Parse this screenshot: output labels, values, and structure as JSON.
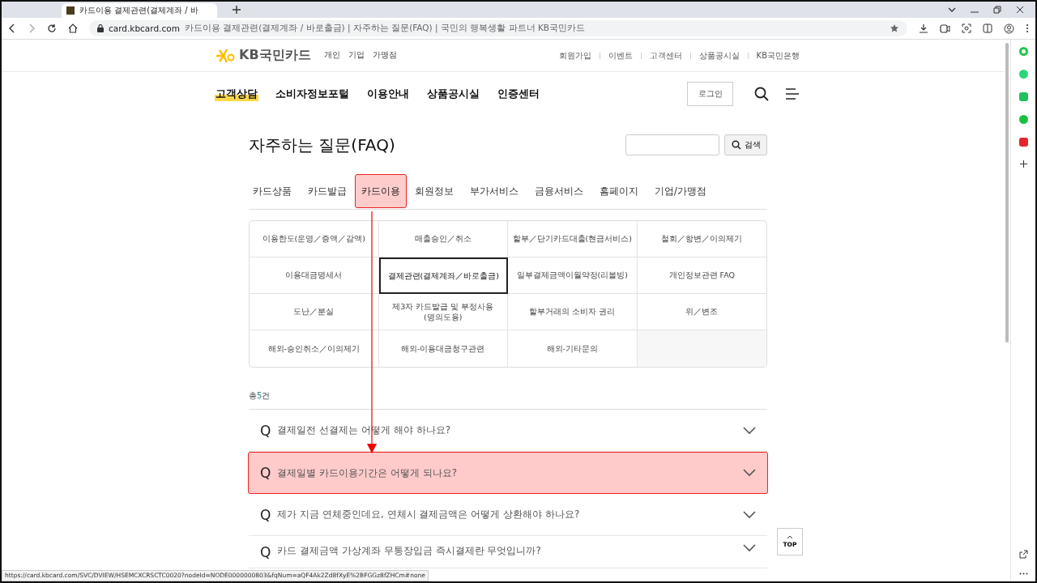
{
  "browser": {
    "tab_title": "카드이용 결제관련(결제계좌 / 바",
    "url_domain": "card.kbcard.com",
    "url_rest": "카드이용 결제관련(결제계좌 / 바로출금) | 자주하는 질문(FAQ) | 국민의 행복생활 파트너 KB국민카드",
    "status_url": "https://card.kbcard.com/SVC/DVIEW/HSEMCXCRSCTC0020?nodeId=NODE0000000803&fqNum=aQF4Ak2Zd8fXyE%2BFGGz8fZHCm#none"
  },
  "header": {
    "logo": "KB국민카드",
    "segments": [
      "개인",
      "기업",
      "가맹점"
    ],
    "utility_links": [
      "회원가입",
      "이벤트",
      "고객센터",
      "상품공시실",
      "KB국민은행"
    ],
    "nav": [
      {
        "label": "고객상담",
        "selected": true
      },
      {
        "label": "소비자정보포털",
        "selected": false
      },
      {
        "label": "이용안내",
        "selected": false
      },
      {
        "label": "상품공시실",
        "selected": false
      },
      {
        "label": "인증센터",
        "selected": false
      }
    ],
    "login": "로그인"
  },
  "page": {
    "title": "자주하는 질문(FAQ)",
    "search_button": "검색",
    "tabs": [
      {
        "label": "카드상품",
        "selected": false
      },
      {
        "label": "카드발급",
        "selected": false
      },
      {
        "label": "카드이용",
        "selected": true
      },
      {
        "label": "회원정보",
        "selected": false
      },
      {
        "label": "부가서비스",
        "selected": false
      },
      {
        "label": "금융서비스",
        "selected": false
      },
      {
        "label": "홈페이지",
        "selected": false
      },
      {
        "label": "기업/가맹점",
        "selected": false
      }
    ],
    "categories": [
      {
        "label": "이용한도(운영／증액／감액)",
        "selected": false
      },
      {
        "label": "매출승인／취소",
        "selected": false
      },
      {
        "label": "할부／단기카드대출(현금서비스)",
        "selected": false
      },
      {
        "label": "철회／항변／이의제기",
        "selected": false
      },
      {
        "label": "이용대금명세서",
        "selected": false
      },
      {
        "label": "결제관련(결제계좌／바로출금)",
        "selected": true
      },
      {
        "label": "일부결제금액이월약정(리볼빙)",
        "selected": false
      },
      {
        "label": "개인정보관련 FAQ",
        "selected": false
      },
      {
        "label": "도난／분실",
        "selected": false
      },
      {
        "label": "제3자 카드발급 및 부정사용\n(명의도용)",
        "selected": false
      },
      {
        "label": "할부거래의 소비자 권리",
        "selected": false
      },
      {
        "label": "위／변조",
        "selected": false
      },
      {
        "label": "해외-승인취소／이의제기",
        "selected": false
      },
      {
        "label": "해외-이용대금청구관련",
        "selected": false
      },
      {
        "label": "해외-기타문의",
        "selected": false
      }
    ],
    "total_prefix": "총",
    "total_count": "5",
    "total_unit": "건",
    "faqs": [
      {
        "q": "Q",
        "text": "결제일전 선결제는 어떻게 해야 하나요?",
        "highlighted": false
      },
      {
        "q": "Q",
        "text": "결제일별 카드이용기간은 어떻게 되나요?",
        "highlighted": true
      },
      {
        "q": "Q",
        "text": "제가 지금 연체중인데요, 연체시 결제금액은 어떻게 상환해야 하나요?",
        "highlighted": false
      },
      {
        "q": "Q",
        "text": "카드 결제금액 가상계좌 무통장입금 즉시결제란 무엇입니까?",
        "highlighted": false
      }
    ],
    "top_button": "TOP"
  }
}
